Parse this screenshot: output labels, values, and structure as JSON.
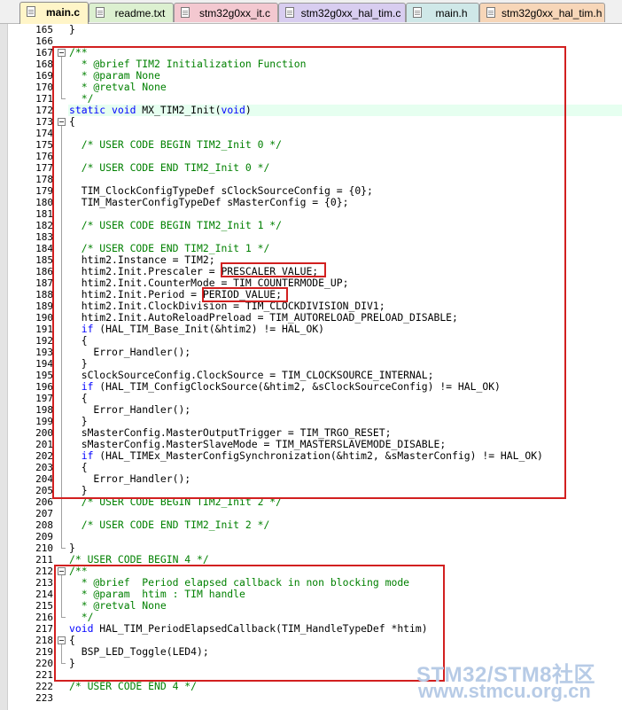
{
  "tabs": [
    {
      "label": "main.c",
      "color": "#fff5c8",
      "active": true
    },
    {
      "label": "readme.txt",
      "color": "#dcf0d0"
    },
    {
      "label": "stm32g0xx_it.c",
      "color": "#f3c8d0"
    },
    {
      "label": "stm32g0xx_hal_tim.c",
      "color": "#d8cdf0"
    },
    {
      "label": "main.h",
      "color": "#cfe8e8"
    },
    {
      "label": "stm32g0xx_hal_tim.h",
      "color": "#f7d6b8"
    }
  ],
  "editor": {
    "lines": [
      {
        "n": "165",
        "t": "}"
      },
      {
        "n": "166",
        "t": ""
      },
      {
        "n": "167",
        "t": "/**",
        "cls": "cm"
      },
      {
        "n": "168",
        "t": "  * @brief TIM2 Initialization Function",
        "cls": "cm"
      },
      {
        "n": "169",
        "t": "  * @param None",
        "cls": "cm"
      },
      {
        "n": "170",
        "t": "  * @retval None",
        "cls": "cm"
      },
      {
        "n": "171",
        "t": "  */",
        "cls": "cm"
      },
      {
        "n": "172",
        "t": "static void MX_TIM2_Init(void)",
        "cls": "mixed172"
      },
      {
        "n": "173",
        "t": "{"
      },
      {
        "n": "174",
        "t": ""
      },
      {
        "n": "175",
        "t": "  /* USER CODE BEGIN TIM2_Init 0 */",
        "cls": "cm"
      },
      {
        "n": "176",
        "t": ""
      },
      {
        "n": "177",
        "t": "  /* USER CODE END TIM2_Init 0 */",
        "cls": "cm"
      },
      {
        "n": "178",
        "t": ""
      },
      {
        "n": "179",
        "t": "  TIM_ClockConfigTypeDef sClockSourceConfig = {0};"
      },
      {
        "n": "180",
        "t": "  TIM_MasterConfigTypeDef sMasterConfig = {0};"
      },
      {
        "n": "181",
        "t": ""
      },
      {
        "n": "182",
        "t": "  /* USER CODE BEGIN TIM2_Init 1 */",
        "cls": "cm"
      },
      {
        "n": "183",
        "t": ""
      },
      {
        "n": "184",
        "t": "  /* USER CODE END TIM2_Init 1 */",
        "cls": "cm"
      },
      {
        "n": "185",
        "t": "  htim2.Instance = TIM2;"
      },
      {
        "n": "186",
        "t": "  htim2.Init.Prescaler = PRESCALER_VALUE;"
      },
      {
        "n": "187",
        "t": "  htim2.Init.CounterMode = TIM_COUNTERMODE_UP;"
      },
      {
        "n": "188",
        "t": "  htim2.Init.Period = PERIOD_VALUE;"
      },
      {
        "n": "189",
        "t": "  htim2.Init.ClockDivision = TIM_CLOCKDIVISION_DIV1;"
      },
      {
        "n": "190",
        "t": "  htim2.Init.AutoReloadPreload = TIM_AUTORELOAD_PRELOAD_DISABLE;"
      },
      {
        "n": "191",
        "t": "  if (HAL_TIM_Base_Init(&htim2) != HAL_OK)",
        "cls": "kwif"
      },
      {
        "n": "192",
        "t": "  {"
      },
      {
        "n": "193",
        "t": "    Error_Handler();"
      },
      {
        "n": "194",
        "t": "  }"
      },
      {
        "n": "195",
        "t": "  sClockSourceConfig.ClockSource = TIM_CLOCKSOURCE_INTERNAL;"
      },
      {
        "n": "196",
        "t": "  if (HAL_TIM_ConfigClockSource(&htim2, &sClockSourceConfig) != HAL_OK)",
        "cls": "kwif"
      },
      {
        "n": "197",
        "t": "  {"
      },
      {
        "n": "198",
        "t": "    Error_Handler();"
      },
      {
        "n": "199",
        "t": "  }"
      },
      {
        "n": "200",
        "t": "  sMasterConfig.MasterOutputTrigger = TIM_TRGO_RESET;"
      },
      {
        "n": "201",
        "t": "  sMasterConfig.MasterSlaveMode = TIM_MASTERSLAVEMODE_DISABLE;"
      },
      {
        "n": "202",
        "t": "  if (HAL_TIMEx_MasterConfigSynchronization(&htim2, &sMasterConfig) != HAL_OK)",
        "cls": "kwif"
      },
      {
        "n": "203",
        "t": "  {"
      },
      {
        "n": "204",
        "t": "    Error_Handler();"
      },
      {
        "n": "205",
        "t": "  }"
      },
      {
        "n": "206",
        "t": "  /* USER CODE BEGIN TIM2_Init 2 */",
        "cls": "cm"
      },
      {
        "n": "207",
        "t": ""
      },
      {
        "n": "208",
        "t": "  /* USER CODE END TIM2_Init 2 */",
        "cls": "cm"
      },
      {
        "n": "209",
        "t": ""
      },
      {
        "n": "210",
        "t": "}"
      },
      {
        "n": "211",
        "t": "/* USER CODE BEGIN 4 */",
        "cls": "cm"
      },
      {
        "n": "212",
        "t": "/**",
        "cls": "cm"
      },
      {
        "n": "213",
        "t": "  * @brief  Period elapsed callback in non blocking mode",
        "cls": "cm"
      },
      {
        "n": "214",
        "t": "  * @param  htim : TIM handle",
        "cls": "cm"
      },
      {
        "n": "215",
        "t": "  * @retval None",
        "cls": "cm"
      },
      {
        "n": "216",
        "t": "  */",
        "cls": "cm"
      },
      {
        "n": "217",
        "t": "void HAL_TIM_PeriodElapsedCallback(TIM_HandleTypeDef *htim)",
        "cls": "kwvoid"
      },
      {
        "n": "218",
        "t": "{"
      },
      {
        "n": "219",
        "t": "  BSP_LED_Toggle(LED4);"
      },
      {
        "n": "220",
        "t": "}"
      },
      {
        "n": "221",
        "t": ""
      },
      {
        "n": "222",
        "t": "/* USER CODE END 4 */",
        "cls": "cm"
      },
      {
        "n": "223",
        "t": ""
      }
    ]
  },
  "watermark": {
    "line1": "STM32/STM8社区",
    "line2": "www.stmcu.org.cn"
  },
  "colors": {
    "highlight_box": "#d22020",
    "comment": "#008000",
    "keyword": "#0000ff",
    "current_line": "#e6fff0"
  }
}
